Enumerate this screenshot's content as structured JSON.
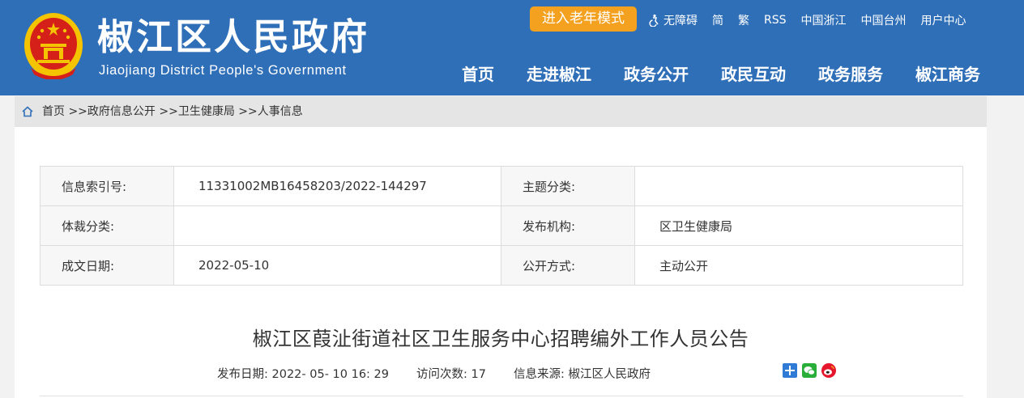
{
  "header": {
    "title": "椒江区人民政府",
    "subtitle": "Jiaojiang District People's Government",
    "elder_mode": "进入老年模式",
    "toplinks": [
      "无障碍",
      "简",
      "繁",
      "RSS",
      "中国浙江",
      "中国台州",
      "用户中心"
    ],
    "nav": [
      "首页",
      "走进椒江",
      "政务公开",
      "政民互动",
      "政务服务",
      "椒江商务"
    ]
  },
  "breadcrumb": [
    "首页",
    " >>政府信息公开",
    " >>卫生健康局",
    " >>人事信息"
  ],
  "meta": {
    "rows": [
      {
        "l1": "信息索引号:",
        "v1": "11331002MB16458203/2022-144297",
        "l2": "主题分类:",
        "v2": ""
      },
      {
        "l1": "体裁分类:",
        "v1": "",
        "l2": "发布机构:",
        "v2": "区卫生健康局"
      },
      {
        "l1": "成文日期:",
        "v1": "2022-05-10",
        "l2": "公开方式:",
        "v2": "主动公开"
      }
    ]
  },
  "article": {
    "title": "椒江区葭沚街道社区卫生服务中心招聘编外工作人员公告",
    "pub_date_label": "发布日期:",
    "pub_date": "2022- 05- 10 16: 29",
    "visits_label": "访问次数:",
    "visits": "17",
    "source_label": "信息来源:",
    "source": "椒江区人民政府"
  },
  "share_icons": [
    "share-plus-icon",
    "wechat-icon",
    "weibo-icon"
  ],
  "colors": {
    "header_bg": "#2f6fb8",
    "elder_btn": "#f3a11f",
    "emblem_red": "#d5201a",
    "emblem_gold": "#f5c400"
  }
}
